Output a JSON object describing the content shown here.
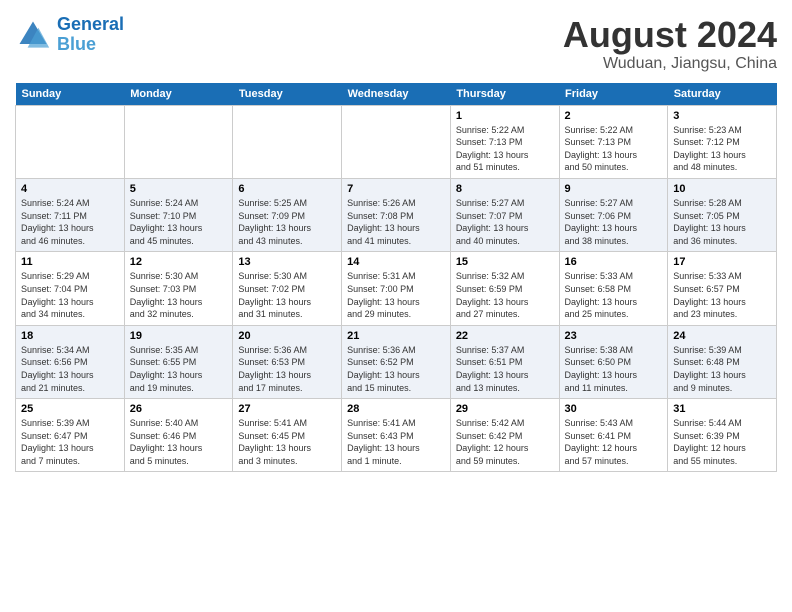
{
  "header": {
    "logo_line1": "General",
    "logo_line2": "Blue",
    "month_title": "August 2024",
    "location": "Wuduan, Jiangsu, China"
  },
  "days_of_week": [
    "Sunday",
    "Monday",
    "Tuesday",
    "Wednesday",
    "Thursday",
    "Friday",
    "Saturday"
  ],
  "weeks": [
    [
      {
        "day": "",
        "info": ""
      },
      {
        "day": "",
        "info": ""
      },
      {
        "day": "",
        "info": ""
      },
      {
        "day": "",
        "info": ""
      },
      {
        "day": "1",
        "info": "Sunrise: 5:22 AM\nSunset: 7:13 PM\nDaylight: 13 hours\nand 51 minutes."
      },
      {
        "day": "2",
        "info": "Sunrise: 5:22 AM\nSunset: 7:13 PM\nDaylight: 13 hours\nand 50 minutes."
      },
      {
        "day": "3",
        "info": "Sunrise: 5:23 AM\nSunset: 7:12 PM\nDaylight: 13 hours\nand 48 minutes."
      }
    ],
    [
      {
        "day": "4",
        "info": "Sunrise: 5:24 AM\nSunset: 7:11 PM\nDaylight: 13 hours\nand 46 minutes."
      },
      {
        "day": "5",
        "info": "Sunrise: 5:24 AM\nSunset: 7:10 PM\nDaylight: 13 hours\nand 45 minutes."
      },
      {
        "day": "6",
        "info": "Sunrise: 5:25 AM\nSunset: 7:09 PM\nDaylight: 13 hours\nand 43 minutes."
      },
      {
        "day": "7",
        "info": "Sunrise: 5:26 AM\nSunset: 7:08 PM\nDaylight: 13 hours\nand 41 minutes."
      },
      {
        "day": "8",
        "info": "Sunrise: 5:27 AM\nSunset: 7:07 PM\nDaylight: 13 hours\nand 40 minutes."
      },
      {
        "day": "9",
        "info": "Sunrise: 5:27 AM\nSunset: 7:06 PM\nDaylight: 13 hours\nand 38 minutes."
      },
      {
        "day": "10",
        "info": "Sunrise: 5:28 AM\nSunset: 7:05 PM\nDaylight: 13 hours\nand 36 minutes."
      }
    ],
    [
      {
        "day": "11",
        "info": "Sunrise: 5:29 AM\nSunset: 7:04 PM\nDaylight: 13 hours\nand 34 minutes."
      },
      {
        "day": "12",
        "info": "Sunrise: 5:30 AM\nSunset: 7:03 PM\nDaylight: 13 hours\nand 32 minutes."
      },
      {
        "day": "13",
        "info": "Sunrise: 5:30 AM\nSunset: 7:02 PM\nDaylight: 13 hours\nand 31 minutes."
      },
      {
        "day": "14",
        "info": "Sunrise: 5:31 AM\nSunset: 7:00 PM\nDaylight: 13 hours\nand 29 minutes."
      },
      {
        "day": "15",
        "info": "Sunrise: 5:32 AM\nSunset: 6:59 PM\nDaylight: 13 hours\nand 27 minutes."
      },
      {
        "day": "16",
        "info": "Sunrise: 5:33 AM\nSunset: 6:58 PM\nDaylight: 13 hours\nand 25 minutes."
      },
      {
        "day": "17",
        "info": "Sunrise: 5:33 AM\nSunset: 6:57 PM\nDaylight: 13 hours\nand 23 minutes."
      }
    ],
    [
      {
        "day": "18",
        "info": "Sunrise: 5:34 AM\nSunset: 6:56 PM\nDaylight: 13 hours\nand 21 minutes."
      },
      {
        "day": "19",
        "info": "Sunrise: 5:35 AM\nSunset: 6:55 PM\nDaylight: 13 hours\nand 19 minutes."
      },
      {
        "day": "20",
        "info": "Sunrise: 5:36 AM\nSunset: 6:53 PM\nDaylight: 13 hours\nand 17 minutes."
      },
      {
        "day": "21",
        "info": "Sunrise: 5:36 AM\nSunset: 6:52 PM\nDaylight: 13 hours\nand 15 minutes."
      },
      {
        "day": "22",
        "info": "Sunrise: 5:37 AM\nSunset: 6:51 PM\nDaylight: 13 hours\nand 13 minutes."
      },
      {
        "day": "23",
        "info": "Sunrise: 5:38 AM\nSunset: 6:50 PM\nDaylight: 13 hours\nand 11 minutes."
      },
      {
        "day": "24",
        "info": "Sunrise: 5:39 AM\nSunset: 6:48 PM\nDaylight: 13 hours\nand 9 minutes."
      }
    ],
    [
      {
        "day": "25",
        "info": "Sunrise: 5:39 AM\nSunset: 6:47 PM\nDaylight: 13 hours\nand 7 minutes."
      },
      {
        "day": "26",
        "info": "Sunrise: 5:40 AM\nSunset: 6:46 PM\nDaylight: 13 hours\nand 5 minutes."
      },
      {
        "day": "27",
        "info": "Sunrise: 5:41 AM\nSunset: 6:45 PM\nDaylight: 13 hours\nand 3 minutes."
      },
      {
        "day": "28",
        "info": "Sunrise: 5:41 AM\nSunset: 6:43 PM\nDaylight: 13 hours\nand 1 minute."
      },
      {
        "day": "29",
        "info": "Sunrise: 5:42 AM\nSunset: 6:42 PM\nDaylight: 12 hours\nand 59 minutes."
      },
      {
        "day": "30",
        "info": "Sunrise: 5:43 AM\nSunset: 6:41 PM\nDaylight: 12 hours\nand 57 minutes."
      },
      {
        "day": "31",
        "info": "Sunrise: 5:44 AM\nSunset: 6:39 PM\nDaylight: 12 hours\nand 55 minutes."
      }
    ]
  ]
}
